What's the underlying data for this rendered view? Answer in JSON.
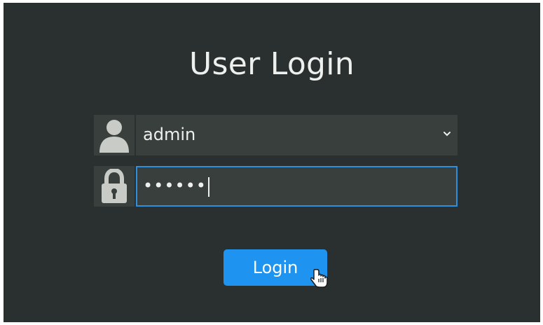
{
  "login": {
    "title": "User Login",
    "username_value": "admin",
    "password_mask": "••••••",
    "button_label": "Login"
  },
  "icons": {
    "user": "user-icon",
    "lock": "lock-icon",
    "dropdown": "chevron-down-icon",
    "cursor": "hand-pointer-cursor"
  },
  "colors": {
    "background": "#2a302f",
    "field": "#393f3d",
    "accent": "#1f93f0",
    "focus_border": "#2e8fe0",
    "icon": "#c9cbc7"
  }
}
